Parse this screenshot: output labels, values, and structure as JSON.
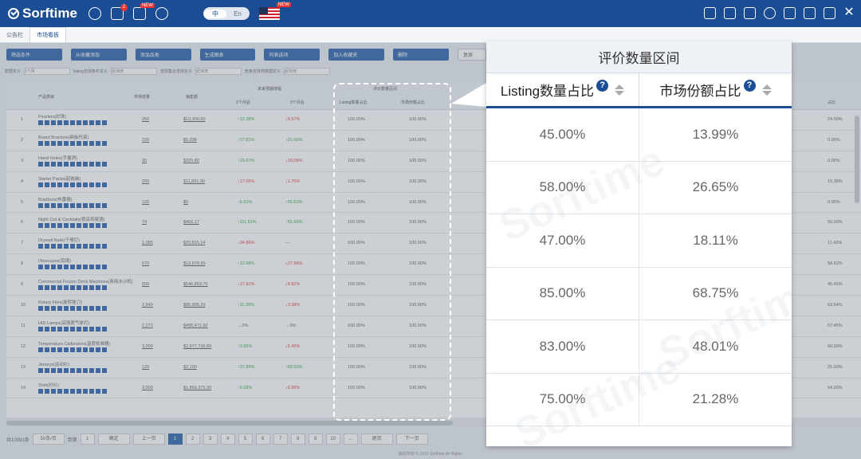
{
  "app": {
    "brand": "Sorftime",
    "lang_toggle": [
      "中",
      "En"
    ],
    "new_badge": "NEW",
    "msg_count": "2"
  },
  "tabs": [
    {
      "label": "公告栏"
    },
    {
      "label": "市场看板",
      "active": true
    }
  ],
  "toolbar": {
    "buttons": [
      "筛选条件",
      "从收藏添加",
      "添加品类",
      "生成图表",
      "列表选项",
      "加入收藏夹",
      "删除"
    ],
    "plain_button": "复原"
  },
  "filters": {
    "labels": [
      "数据定义",
      "listing支持条件定义",
      "选择集合支持定义",
      "竞争支持类数据定义"
    ],
    "selects": [
      "1个月",
      "近30天",
      "近30天",
      "近30天"
    ]
  },
  "table": {
    "headers": {
      "checkbox": "",
      "product": "产品类目",
      "market_size": "市场容量",
      "sales": "销售额",
      "trend_group": "未来预期增幅",
      "trend_2m": "2个月后",
      "trend_3m": "3个月后",
      "rating_group": "评价数量区间",
      "listing_share": "Listing数量占比",
      "market_share": "市场份额占比",
      "right_col": "占比"
    },
    "rows": [
      {
        "no": "1",
        "name": "Pearlers(珍珠)",
        "c1": "250",
        "c2": "$13,300.60",
        "c3": "↑12.38%",
        "c4": "↓6.57%",
        "c5": "100.00%",
        "c6": "100.00%",
        "c7": "24.00%"
      },
      {
        "no": "2",
        "name": "Board Brackets(画板托架)",
        "c1": "150",
        "c2": "$5,298",
        "c3": "↑27.81%",
        "c4": "↑21.55%",
        "c5": "100.00%",
        "c6": "100.00%",
        "c7": "0.00%"
      },
      {
        "no": "3",
        "name": "Hand Holes(手握洞)",
        "c1": "30",
        "c2": "$325.80",
        "c3": "↑29.67%",
        "c4": "↓20.09%",
        "c5": "100.00%",
        "c6": "100.00%",
        "c7": "0.00%"
      },
      {
        "no": "4",
        "name": "Starter Packs(起始装)",
        "c1": "290",
        "c2": "$11,891.90",
        "c3": "↓17.06%",
        "c4": "↓1.75%",
        "c5": "100.00%",
        "c6": "100.00%",
        "c7": "15.38%"
      },
      {
        "no": "5",
        "name": "Bradburs(布雷德)",
        "c1": "120",
        "c2": "$0",
        "c3": "↑6.51%",
        "c4": "↑55.61%",
        "c5": "100.00%",
        "c6": "100.00%",
        "c7": "0.00%"
      },
      {
        "no": "6",
        "name": "Night Out & Cocktails(夜店鸡尾酒)",
        "c1": "74",
        "c2": "$466.17",
        "c3": "↑111.51%",
        "c4": "↑52.69%",
        "c5": "100.00%",
        "c6": "100.00%",
        "c7": "50.00%"
      },
      {
        "no": "7",
        "name": "Drywall Nails(干墙钉)",
        "c1": "1,085",
        "c2": "$20,815.14",
        "c3": "↓34.86%",
        "c4": "---",
        "c5": "100.00%",
        "c6": "100.00%",
        "c7": "11.43%"
      },
      {
        "no": "8",
        "name": "Otoscopes(耳镜)",
        "c1": "670",
        "c2": "$13,978.90",
        "c3": "↑12.08%",
        "c4": "↓27.96%",
        "c5": "100.00%",
        "c6": "100.00%",
        "c7": "58.62%"
      },
      {
        "no": "9",
        "name": "Commercial Frozen Drink Machines(商用冰沙机)",
        "c1": "550",
        "c2": "$546,853.70",
        "c3": "↓17.91%",
        "c4": "↓8.81%",
        "c5": "100.00%",
        "c6": "100.00%",
        "c7": "45.45%"
      },
      {
        "no": "10",
        "name": "Rotary Files(旋转锉刀)",
        "c1": "2,640",
        "c2": "$85,905.20",
        "c3": "↑11.39%",
        "c4": "↓3.38%",
        "c5": "100.00%",
        "c6": "100.00%",
        "c7": "63.64%"
      },
      {
        "no": "11",
        "name": "HID Lamps(高强度气体灯)",
        "c1": "2,273",
        "c2": "$458,471.92",
        "c3": "→0%",
        "c4": "→0%",
        "c5": "100.00%",
        "c6": "100.00%",
        "c7": "57.45%"
      },
      {
        "no": "12",
        "name": "Temperature Calibrators(温度校准器)",
        "c1": "3,000",
        "c2": "$2,977,736.80",
        "c3": "↑9.95%",
        "c4": "↓5.45%",
        "c5": "100.00%",
        "c6": "100.00%",
        "c7": "60.00%"
      },
      {
        "no": "13",
        "name": "Jerseys(运动衫)",
        "c1": "120",
        "c2": "$2,190",
        "c3": "↑27.89%",
        "c4": "↑83.03%",
        "c5": "100.00%",
        "c6": "100.00%",
        "c7": "25.00%"
      },
      {
        "no": "14",
        "name": "Shirt(衬衫)",
        "c1": "3,000",
        "c2": "$1,869,375.30",
        "c3": "↑6.03%",
        "c4": "↓6.90%",
        "c5": "100.00%",
        "c6": "100.00%",
        "c7": "54.00%"
      }
    ]
  },
  "pager": {
    "total": "共10091条",
    "per_page": "50条/页",
    "jump_label": "到第",
    "jump_value": "1",
    "confirm": "确定",
    "prev": "上一页",
    "pages": [
      "1",
      "2",
      "3",
      "4",
      "5",
      "6",
      "7",
      "8",
      "9",
      "10",
      "..."
    ],
    "last": "尾页",
    "next": "下一页"
  },
  "footer": "版权所有 © 2019 Sorftime All Rights",
  "zoom_panel": {
    "title": "评价数量区间",
    "col1": "Listing数量占比",
    "col2": "市场份额占比",
    "help": "?",
    "rows": [
      [
        "45.00%",
        "13.99%"
      ],
      [
        "58.00%",
        "26.65%"
      ],
      [
        "47.00%",
        "18.11%"
      ],
      [
        "85.00%",
        "68.75%"
      ],
      [
        "83.00%",
        "48.01%"
      ],
      [
        "75.00%",
        "21.28%"
      ]
    ]
  },
  "watermark": "Sorftime"
}
